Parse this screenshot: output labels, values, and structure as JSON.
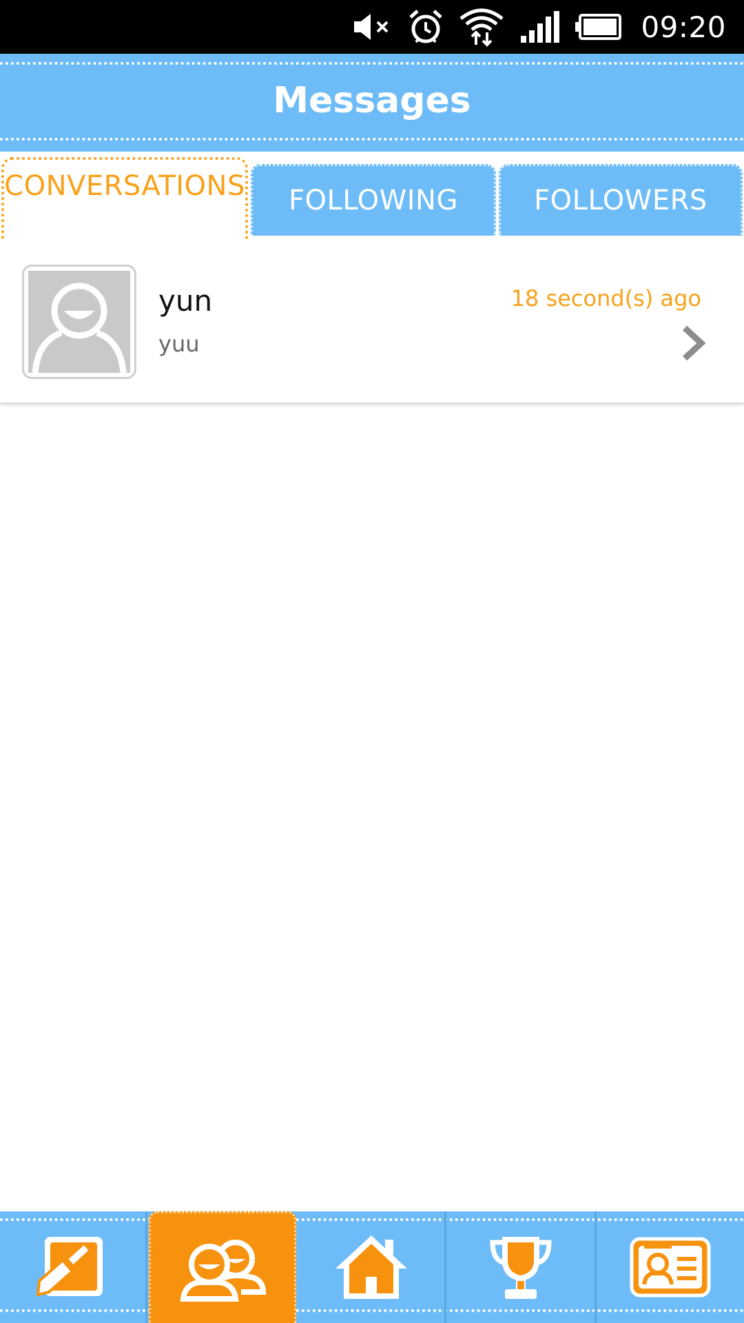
{
  "status_bar": {
    "time": "09:20",
    "icons": [
      "mute-icon",
      "alarm-icon",
      "wifi-icon",
      "signal-icon",
      "battery-icon"
    ]
  },
  "header": {
    "title": "Messages"
  },
  "tabs": [
    {
      "label": "CONVERSATIONS",
      "active": true
    },
    {
      "label": "FOLLOWING",
      "active": false
    },
    {
      "label": "FOLLOWERS",
      "active": false
    }
  ],
  "conversations": [
    {
      "name": "yun",
      "preview": "yuu",
      "time": "18 second(s) ago"
    }
  ],
  "bottom_nav": [
    {
      "icon": "note-pencil-icon",
      "active": false
    },
    {
      "icon": "friends-icon",
      "active": true
    },
    {
      "icon": "home-icon",
      "active": false
    },
    {
      "icon": "trophy-icon",
      "active": false
    },
    {
      "icon": "profile-card-icon",
      "active": false
    }
  ],
  "colors": {
    "primary_blue": "#6dbcf7",
    "accent_orange": "#f7920e",
    "text_orange": "#f7a11a"
  }
}
